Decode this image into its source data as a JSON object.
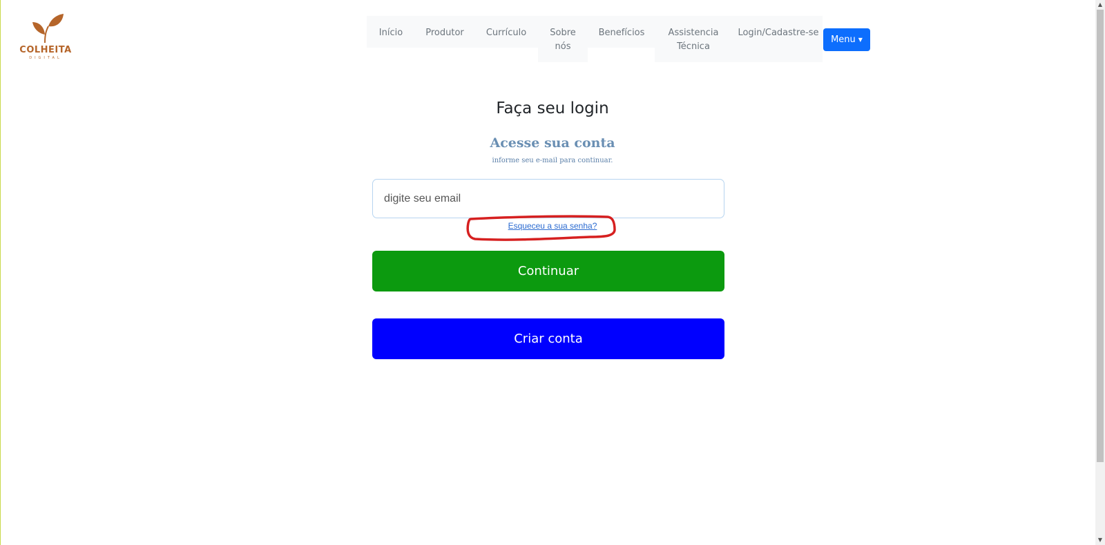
{
  "brand": {
    "logo_name": "COLHEITA",
    "logo_sub": "DIGITAL",
    "logo_color": "#b5652a"
  },
  "nav": {
    "items": [
      "Início",
      "Produtor",
      "Currículo",
      "Sobre nós",
      "Benefícios",
      "Assistencia Técnica",
      "Login/Cadastre-se"
    ],
    "menu_label": "Menu",
    "menu_button_color": "#0d6efd"
  },
  "login": {
    "title": "Faça seu login",
    "subtitle": "Acesse sua conta",
    "hint": "informe seu e-mail para continuar.",
    "email_placeholder": "digite seu email",
    "forgot_link": "Esqueceu a sua senha?",
    "continue_label": "Continuar",
    "create_label": "Criar conta",
    "continue_color": "#0c9a0f",
    "create_color": "#0000ff",
    "annotation_color": "#d62020"
  }
}
